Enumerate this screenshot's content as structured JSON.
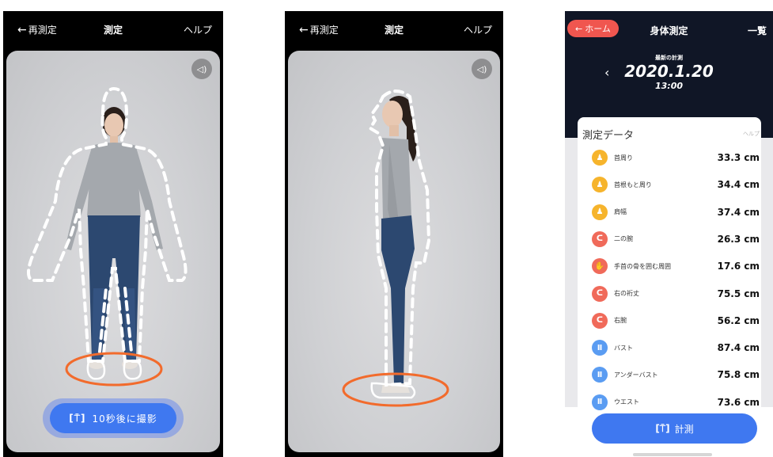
{
  "screens": {
    "front": {
      "back_label": "再測定",
      "title": "測定",
      "help": "ヘルプ",
      "capture_button": "10秒後に撮影"
    },
    "side": {
      "back_label": "再測定",
      "title": "測定",
      "help": "ヘルプ"
    },
    "results": {
      "home_button": "ホーム",
      "title": "身体測定",
      "list_button": "一覧",
      "latest_caption": "最新の計測",
      "date": "2020.1.20",
      "time": "13:00",
      "card_title": "測定データ",
      "card_help": "ヘルプ",
      "measurements": [
        {
          "label": "首周り",
          "value": "33.3 cm",
          "icon": "person-icon",
          "color": "#f6b42c"
        },
        {
          "label": "首根もと周り",
          "value": "34.4 cm",
          "icon": "person-icon",
          "color": "#f6b42c"
        },
        {
          "label": "肩幅",
          "value": "37.4 cm",
          "icon": "person-icon",
          "color": "#f6b42c"
        },
        {
          "label": "二の腕",
          "value": "26.3 cm",
          "icon": "arm-icon",
          "color": "#f06a5a"
        },
        {
          "label": "手首の骨を囲む周囲",
          "value": "17.6 cm",
          "icon": "hand-icon",
          "color": "#f06a5a"
        },
        {
          "label": "右の裄丈",
          "value": "75.5 cm",
          "icon": "arm-icon",
          "color": "#f06a5a"
        },
        {
          "label": "右腕",
          "value": "56.2 cm",
          "icon": "arm-icon",
          "color": "#f06a5a"
        },
        {
          "label": "バスト",
          "value": "87.4 cm",
          "icon": "torso-icon",
          "color": "#5a9cf2"
        },
        {
          "label": "アンダーバスト",
          "value": "75.8 cm",
          "icon": "torso-icon",
          "color": "#5a9cf2"
        },
        {
          "label": "ウエスト",
          "value": "73.6 cm",
          "icon": "torso-icon",
          "color": "#5a9cf2"
        }
      ],
      "measure_button": "計測"
    }
  },
  "colors": {
    "accent_blue": "#3f78f0",
    "home_red": "#f0564f",
    "header_navy": "#101626"
  }
}
